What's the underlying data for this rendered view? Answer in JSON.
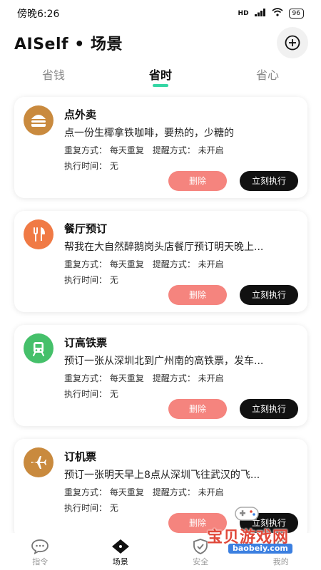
{
  "status_bar": {
    "time": "傍晚6:26",
    "network": "HD",
    "battery": "96"
  },
  "header": {
    "title": "AISelf • 场景"
  },
  "tabs": [
    {
      "label": "省钱",
      "active": false
    },
    {
      "label": "省时",
      "active": true
    },
    {
      "label": "省心",
      "active": false
    }
  ],
  "colors": {
    "accent": "#34d6a4",
    "delete": "#f5847e",
    "execute": "#111111"
  },
  "cards": [
    {
      "icon": "burger-icon",
      "icon_color": "#c98a3e",
      "title": "点外卖",
      "desc": "点一份生椰拿铁咖啡，要热的，少糖的",
      "repeat": "重复方式：  每天重复",
      "remind": "提醒方式：  未开启",
      "time": "执行时间：  无",
      "delete_label": "删除",
      "execute_label": "立刻执行"
    },
    {
      "icon": "cutlery-icon",
      "icon_color": "#f07a45",
      "title": "餐厅预订",
      "desc": "帮我在大自然醉鹅岗头店餐厅预订明天晚上...",
      "repeat": "重复方式：  每天重复",
      "remind": "提醒方式：  未开启",
      "time": "执行时间：  无",
      "delete_label": "删除",
      "execute_label": "立刻执行"
    },
    {
      "icon": "train-icon",
      "icon_color": "#45c06a",
      "title": "订高铁票",
      "desc": "预订一张从深圳北到广州南的高铁票，发车...",
      "repeat": "重复方式：  每天重复",
      "remind": "提醒方式：  未开启",
      "time": "执行时间：  无",
      "delete_label": "删除",
      "execute_label": "立刻执行"
    },
    {
      "icon": "airplane-icon",
      "icon_color": "#c98a3e",
      "title": "订机票",
      "desc": "预订一张明天早上8点从深圳飞往武汉的飞...",
      "repeat": "重复方式：  每天重复",
      "remind": "提醒方式：  未开启",
      "time": "执行时间：  无",
      "delete_label": "删除",
      "execute_label": "立刻执行"
    }
  ],
  "bottom_nav": [
    {
      "label": "指令",
      "icon": "chat-icon",
      "active": false
    },
    {
      "label": "场景",
      "icon": "scene-icon",
      "active": true
    },
    {
      "label": "安全",
      "icon": "shield-icon",
      "active": false
    },
    {
      "label": "我的",
      "icon": "profile-icon",
      "active": false
    }
  ],
  "watermark": {
    "text": "宝贝游戏网",
    "url": "baobeiy.com"
  }
}
